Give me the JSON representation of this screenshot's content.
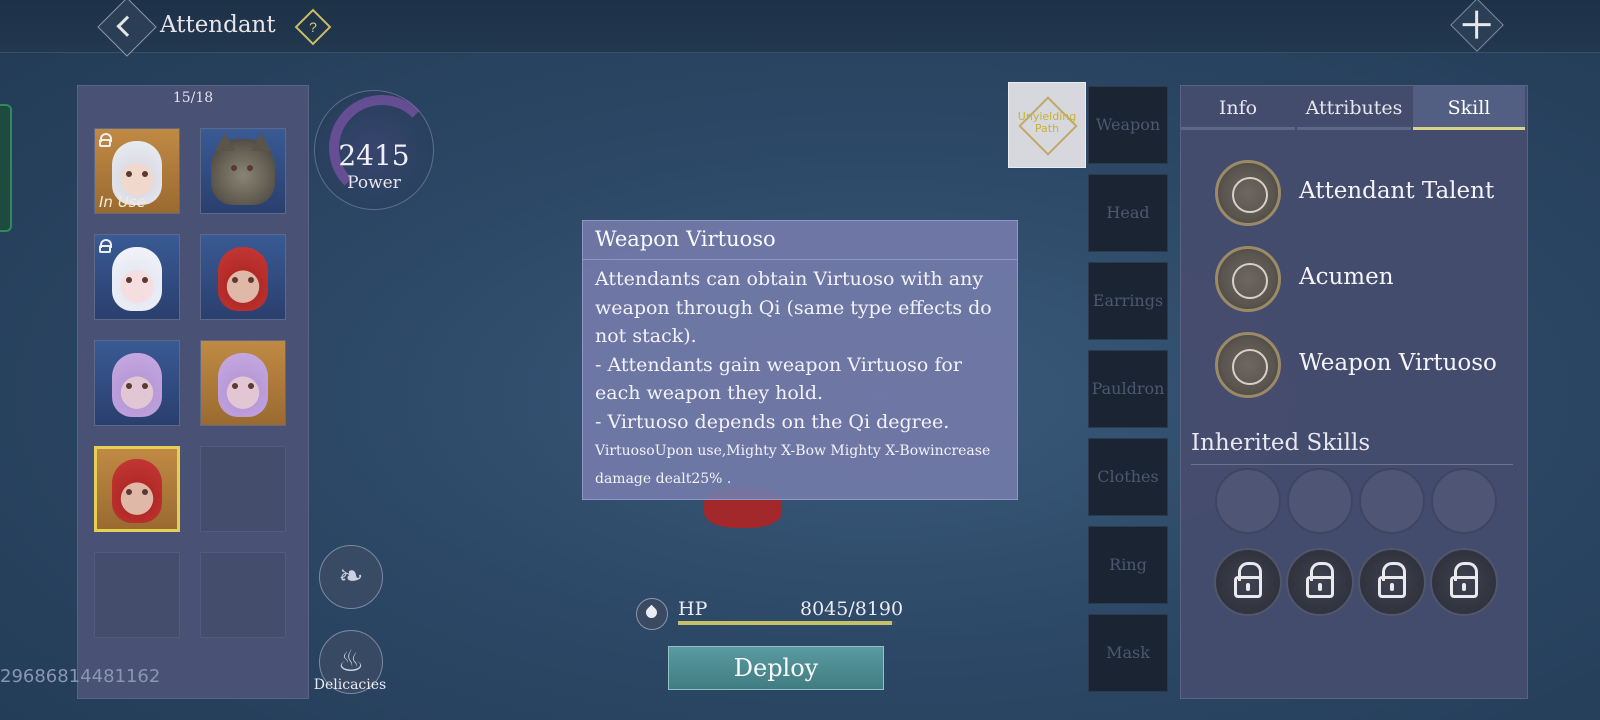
{
  "header": {
    "title": "Attendant",
    "help_symbol": "?"
  },
  "roster": {
    "count": "15/18",
    "slots": [
      {
        "portrait": "white-hair",
        "in_use": "In Use",
        "locked": true,
        "frame": "orange"
      },
      {
        "portrait": "cat",
        "locked": false,
        "frame": "blue"
      },
      {
        "portrait": "doll",
        "locked": true,
        "frame": "blue"
      },
      {
        "portrait": "red-hair",
        "locked": false,
        "frame": "blue"
      },
      {
        "portrait": "lilac-hair",
        "locked": false,
        "frame": "blue"
      },
      {
        "portrait": "lilac-hair",
        "locked": false,
        "frame": "orange"
      },
      {
        "portrait": "red-hair",
        "locked": false,
        "frame": "orange",
        "selected": true
      },
      {
        "portrait": null
      },
      {
        "portrait": null
      },
      {
        "portrait": null
      }
    ]
  },
  "power": {
    "value": "2415",
    "label": "Power"
  },
  "side_buttons": {
    "delicacies_label": "Delicacies"
  },
  "uid": "29686814481162",
  "tooltip": {
    "title": "Weapon Virtuoso",
    "body": "Attendants can obtain Virtuoso with any\nweapon through Qi (same type effects do\nnot stack).\n- Attendants gain weapon Virtuoso for\neach weapon they hold.\n- Virtuoso depends on the Qi degree.",
    "note": " VirtuosoUpon use,Mighty X-Bow Mighty X-Bowincrease\ndamage dealt25% ."
  },
  "hp": {
    "label": "HP",
    "value": "8045/8190",
    "fraction": 0.982
  },
  "deploy_label": "Deploy",
  "gear": {
    "thumb_text": "Unyielding Path",
    "slots": [
      "Weapon",
      "Head",
      "Earrings",
      "Pauldron",
      "Clothes",
      "Ring",
      "Mask"
    ]
  },
  "panel": {
    "tabs": [
      "Info",
      "Attributes",
      "Skill"
    ],
    "active_tab": "Skill",
    "skills": [
      "Attendant Talent",
      "Acumen",
      "Weapon Virtuoso"
    ],
    "inherited_title": "Inherited Skills"
  },
  "colors": {
    "accent": "#d7d489",
    "selected_frame": "#e6cf55",
    "deploy": "#4f8c92"
  }
}
